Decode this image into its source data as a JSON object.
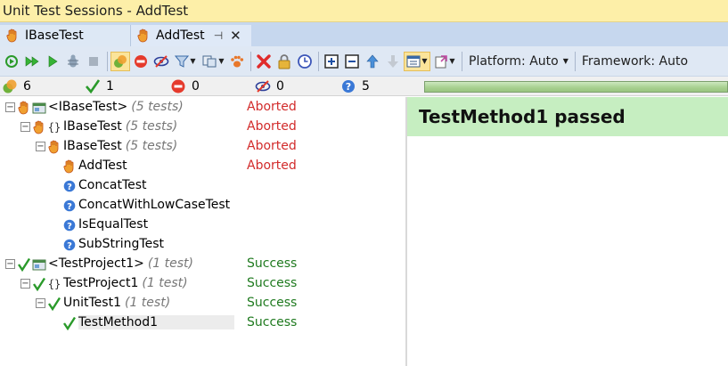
{
  "window": {
    "title": "Unit Test Sessions - AddTest"
  },
  "tabs": [
    {
      "label": "IBaseTest",
      "icon": "hand-stop-icon",
      "active": false
    },
    {
      "label": "AddTest",
      "icon": "hand-stop-icon",
      "active": true,
      "pin": "⊣",
      "close": "✕"
    }
  ],
  "toolbar": {
    "platform_label": "Platform: Auto",
    "framework_label": "Framework: Auto",
    "buttons": [
      "run-all-icon",
      "run-icon",
      "debug-icon",
      "stop-icon",
      "build-icon",
      "show-all-icon",
      "show-failed-icon",
      "show-ignored-icon",
      "filter-icon",
      "group-by-icon",
      "track-running-icon",
      "remove-icon",
      "lock-icon",
      "history-icon",
      "expand-all-icon",
      "collapse-all-icon",
      "previous-icon",
      "next-icon",
      "layout-icon",
      "export-icon"
    ]
  },
  "status": {
    "total": "6",
    "passed": "1",
    "failed": "0",
    "ignored": "0",
    "unknown": "5",
    "progress": 1.0
  },
  "tree": {
    "rows": [
      {
        "label": "<IBaseTest>",
        "count": "(5 tests)",
        "result": "Aborted",
        "status": "aborted",
        "kind": "project"
      },
      {
        "label": "IBaseTest",
        "count": "(5 tests)",
        "result": "Aborted",
        "status": "aborted",
        "kind": "namespace"
      },
      {
        "label": "IBaseTest",
        "count": "(5 tests)",
        "result": "Aborted",
        "status": "aborted",
        "kind": "class"
      },
      {
        "label": "AddTest",
        "count": "",
        "result": "Aborted",
        "status": "aborted",
        "kind": "method"
      },
      {
        "label": "ConcatTest",
        "count": "",
        "result": "",
        "status": "unknown",
        "kind": "method"
      },
      {
        "label": "ConcatWithLowCaseTest",
        "count": "",
        "result": "",
        "status": "unknown",
        "kind": "method"
      },
      {
        "label": "IsEqualTest",
        "count": "",
        "result": "",
        "status": "unknown",
        "kind": "method"
      },
      {
        "label": "SubStringTest",
        "count": "",
        "result": "",
        "status": "unknown",
        "kind": "method"
      },
      {
        "label": "<TestProject1>",
        "count": "(1 test)",
        "result": "Success",
        "status": "success",
        "kind": "project"
      },
      {
        "label": "TestProject1",
        "count": "(1 test)",
        "result": "Success",
        "status": "success",
        "kind": "namespace"
      },
      {
        "label": "UnitTest1",
        "count": "(1 test)",
        "result": "Success",
        "status": "success",
        "kind": "class"
      },
      {
        "label": "TestMethod1",
        "count": "",
        "result": "Success",
        "status": "success",
        "kind": "method",
        "selected": true
      }
    ]
  },
  "detail": {
    "banner": "TestMethod1 passed"
  },
  "colors": {
    "aborted": "#d22b2b",
    "success": "#1f7a1f",
    "banner_bg": "#c6eec1",
    "title_bg": "#fdefa8",
    "tab_bg": "#c6d7ee"
  }
}
